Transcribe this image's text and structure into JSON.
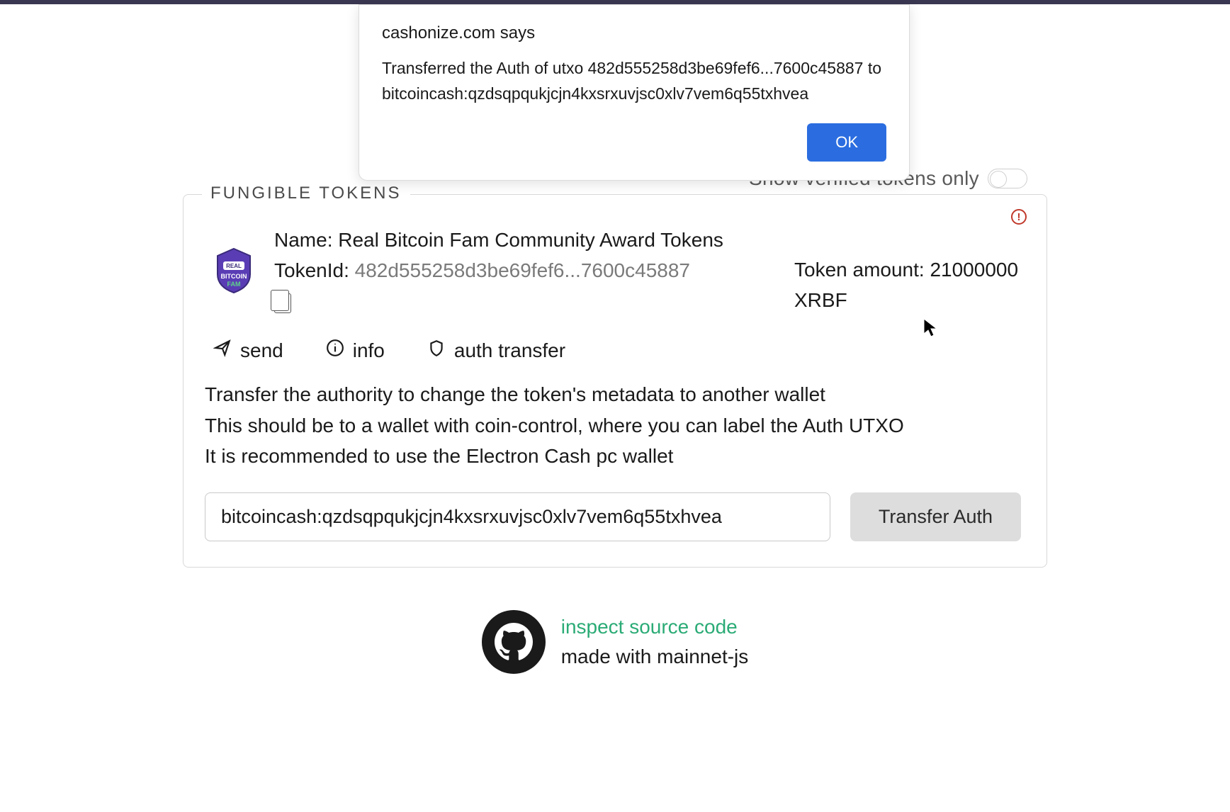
{
  "dialog": {
    "origin_label": "cashonize.com says",
    "message": "Transferred the Auth of utxo 482d555258d3be69fef6...7600c45887 to bitcoincash:qzdsqpqukjcjn4kxsrxuvjsc0xlv7vem6q55txhvea",
    "ok_label": "OK"
  },
  "verified": {
    "label": "Show verified tokens only"
  },
  "section": {
    "legend": "FUNGIBLE TOKENS"
  },
  "token": {
    "name_prefix": "Name: ",
    "name": "Real Bitcoin Fam Community Award Tokens",
    "id_prefix": "TokenId: ",
    "id": "482d555258d3be69fef6...7600c45887",
    "amount_prefix": "Token amount: ",
    "amount": "21000000",
    "symbol": "XRBF",
    "actions": {
      "send": "send",
      "info": "info",
      "auth": "auth transfer"
    }
  },
  "auth_transfer": {
    "line1": "Transfer the authority to change the token's metadata to another wallet",
    "line2": "This should be to a wallet with coin-control, where you can label the Auth UTXO",
    "line3": "It is recommended to use the Electron Cash pc wallet",
    "address": "bitcoincash:qzdsqpqukjcjn4kxsrxuvjsc0xlv7vem6q55txhvea",
    "button": "Transfer Auth"
  },
  "footer": {
    "link": "inspect source code",
    "madewith": "made with mainnet-js"
  }
}
